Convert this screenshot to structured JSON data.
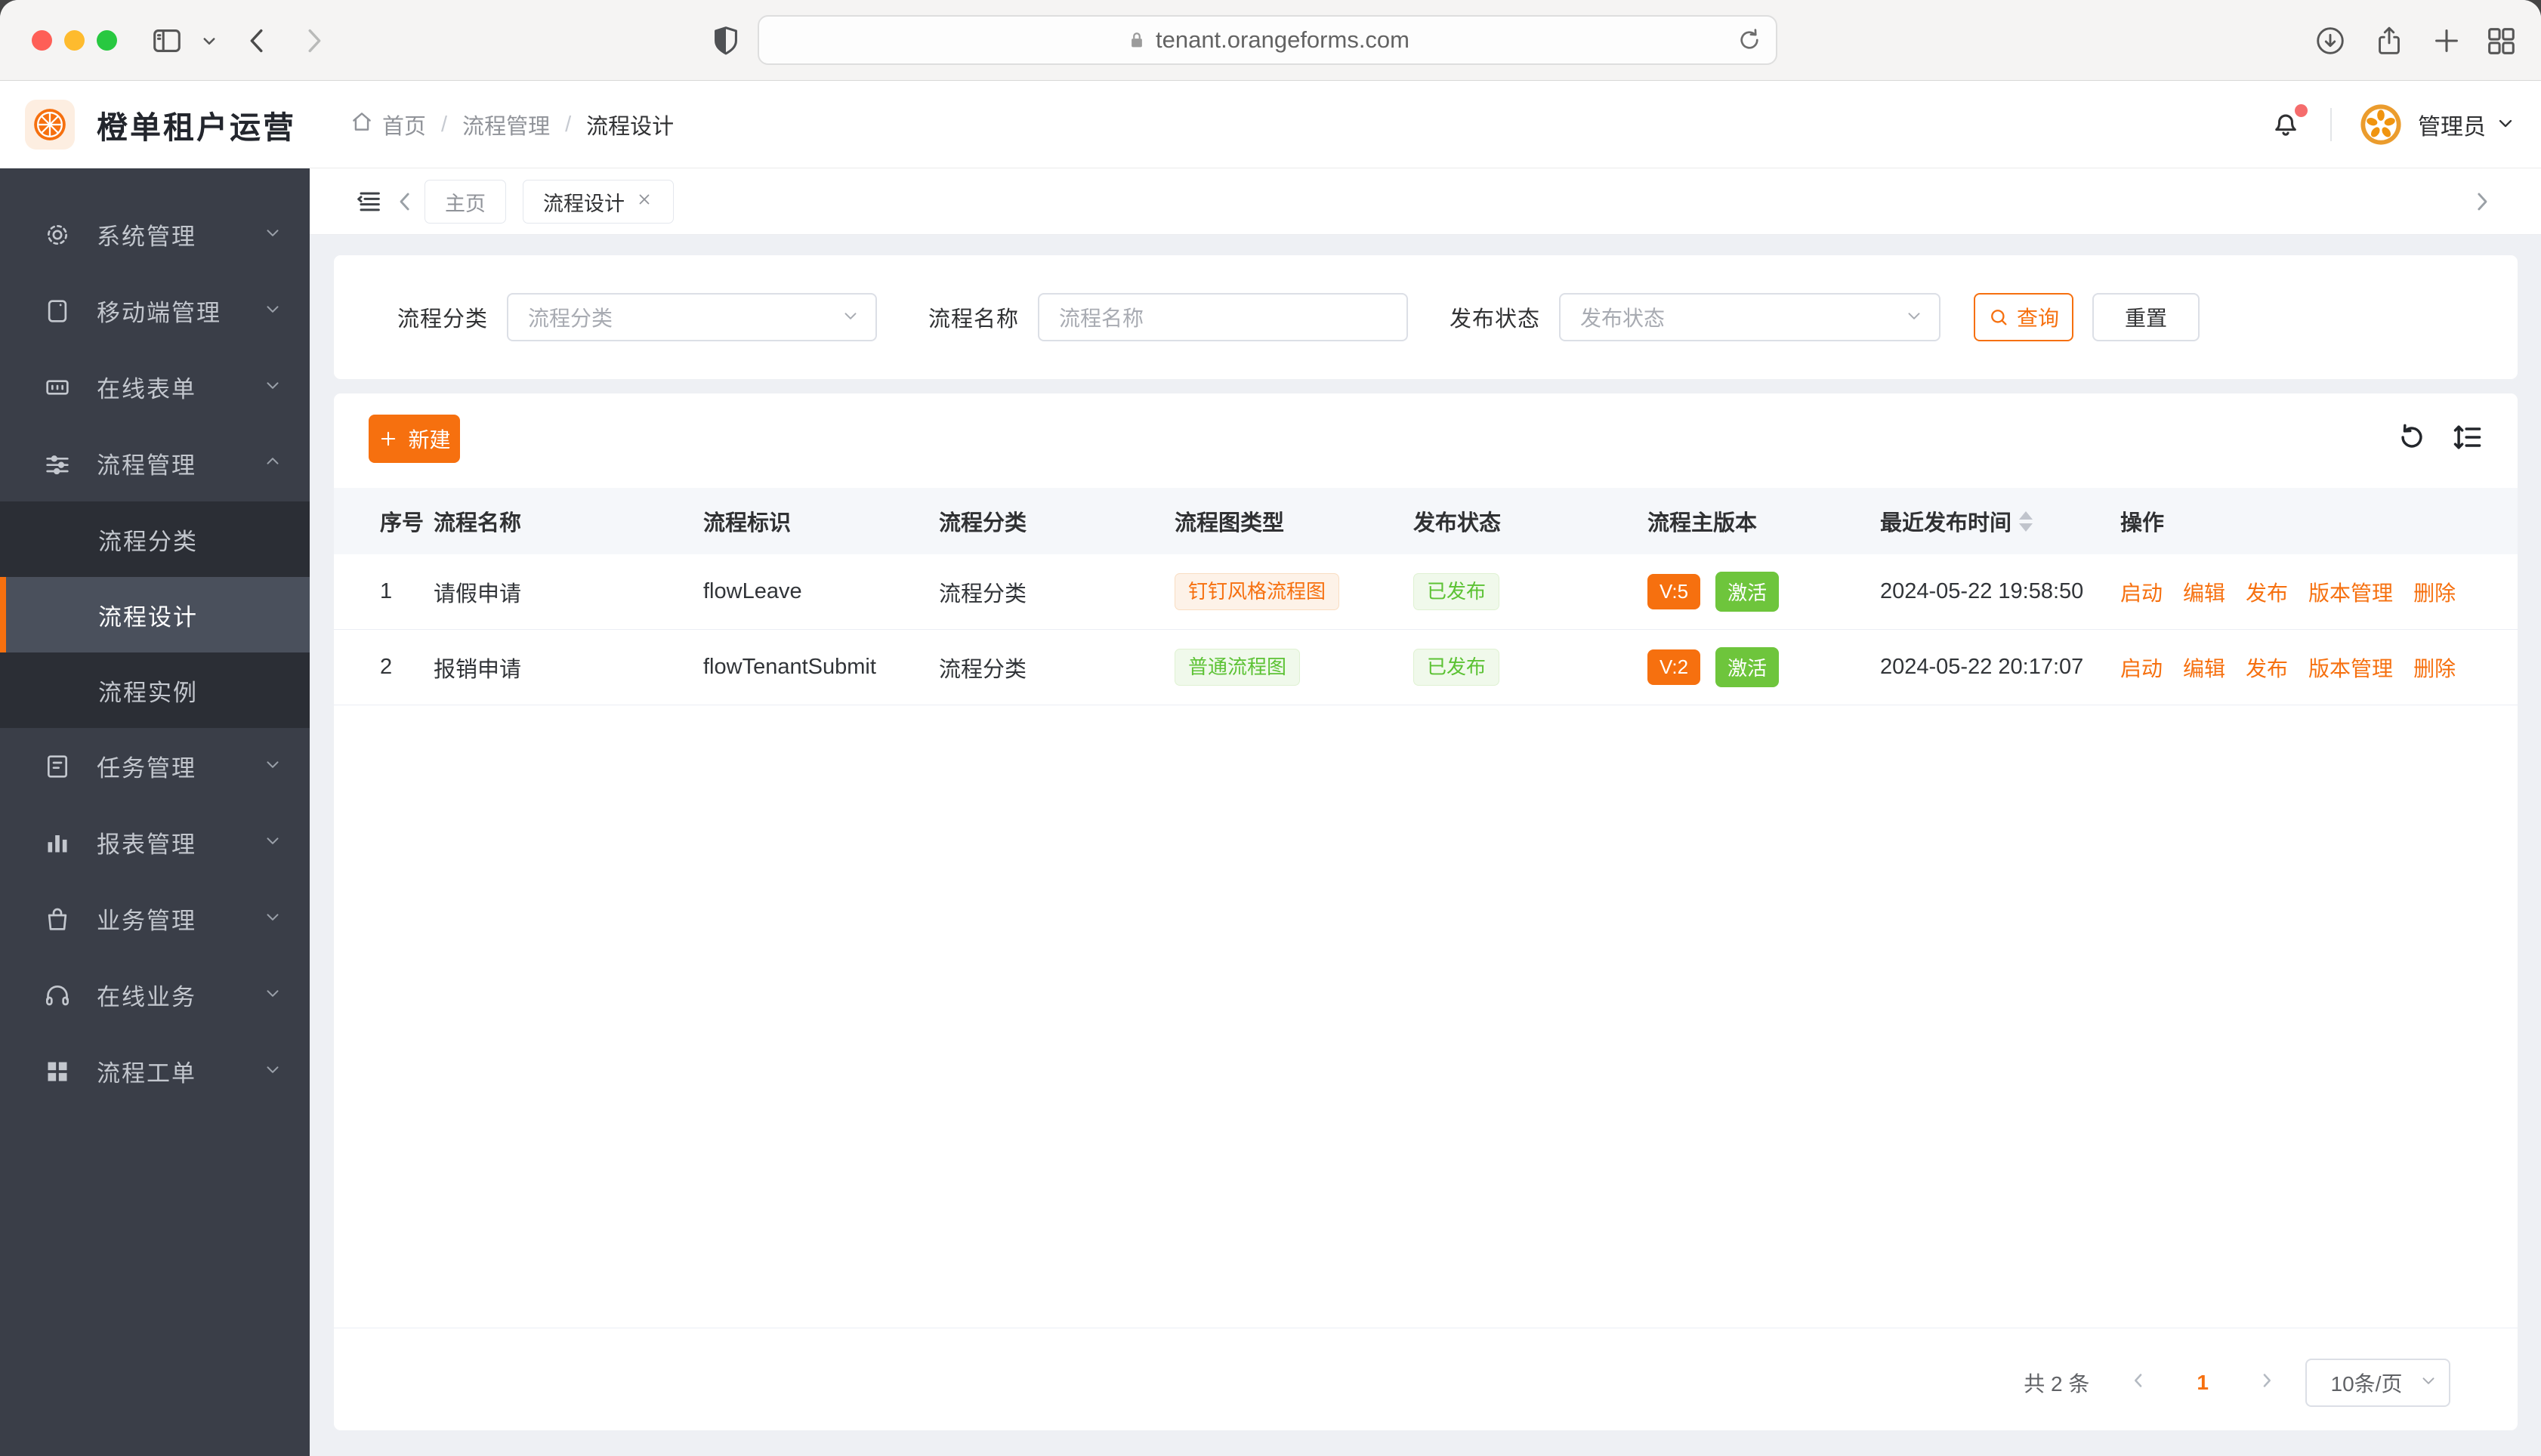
{
  "browser": {
    "url": "tenant.orangeforms.com"
  },
  "header": {
    "app_title": "橙单租户运营",
    "breadcrumb": [
      {
        "label": "首页",
        "icon": "home-icon"
      },
      {
        "label": "流程管理"
      },
      {
        "label": "流程设计",
        "current": true
      }
    ],
    "unread_dot": true,
    "user_name": "管理员"
  },
  "sidebar": {
    "items": [
      {
        "label": "系统管理",
        "icon": "gear-icon"
      },
      {
        "label": "移动端管理",
        "icon": "mobile-icon"
      },
      {
        "label": "在线表单",
        "icon": "form-icon"
      },
      {
        "label": "流程管理",
        "icon": "sliders-icon",
        "expanded": true,
        "children": [
          {
            "label": "流程分类"
          },
          {
            "label": "流程设计",
            "active": true
          },
          {
            "label": "流程实例"
          }
        ]
      },
      {
        "label": "任务管理",
        "icon": "tasks-icon"
      },
      {
        "label": "报表管理",
        "icon": "chart-icon"
      },
      {
        "label": "业务管理",
        "icon": "bag-icon"
      },
      {
        "label": "在线业务",
        "icon": "headset-icon"
      },
      {
        "label": "流程工单",
        "icon": "grid-icon"
      }
    ]
  },
  "tabs": [
    {
      "label": "主页",
      "active": false,
      "closable": false
    },
    {
      "label": "流程设计",
      "active": true,
      "closable": true
    }
  ],
  "filters": {
    "category": {
      "label": "流程分类",
      "placeholder": "流程分类"
    },
    "name": {
      "label": "流程名称",
      "placeholder": "流程名称"
    },
    "status": {
      "label": "发布状态",
      "placeholder": "发布状态"
    },
    "search_label": "查询",
    "reset_label": "重置"
  },
  "toolbar": {
    "create_label": "新建"
  },
  "table": {
    "columns": [
      {
        "label": "序号"
      },
      {
        "label": "流程名称"
      },
      {
        "label": "流程标识"
      },
      {
        "label": "流程分类"
      },
      {
        "label": "流程图类型"
      },
      {
        "label": "发布状态"
      },
      {
        "label": "流程主版本"
      },
      {
        "label": "最近发布时间",
        "sortable": true
      },
      {
        "label": "操作"
      }
    ],
    "rows": [
      {
        "index": "1",
        "name": "请假申请",
        "key": "flowLeave",
        "category": "流程分类",
        "diagram_type": "钉钉风格流程图",
        "diagram_variant": "orange",
        "publish_status": "已发布",
        "version": "V:5",
        "active_label": "激活",
        "published_at": "2024-05-22 19:58:50"
      },
      {
        "index": "2",
        "name": "报销申请",
        "key": "flowTenantSubmit",
        "category": "流程分类",
        "diagram_type": "普通流程图",
        "diagram_variant": "green",
        "publish_status": "已发布",
        "version": "V:2",
        "active_label": "激活",
        "published_at": "2024-05-22 20:17:07"
      }
    ],
    "row_actions": [
      "启动",
      "编辑",
      "发布",
      "版本管理",
      "删除"
    ],
    "row_action_names": [
      "start",
      "edit",
      "publish",
      "version-manage",
      "delete"
    ]
  },
  "pagination": {
    "total_label": "共 2 条",
    "page": "1",
    "page_size_label": "10条/页"
  },
  "colors": {
    "primary": "#f6700f",
    "success_text": "#5cc234",
    "success_solid": "#6ec53c",
    "badge_orange_bg": "#fdf2e8",
    "badge_green_bg": "#f0f9eb",
    "sidebar_bg": "#3a3e48",
    "sidebar_submenu_bg": "#2b2e35",
    "sidebar_active_bg": "#4a505c",
    "red_dot": "#f56c6c"
  }
}
